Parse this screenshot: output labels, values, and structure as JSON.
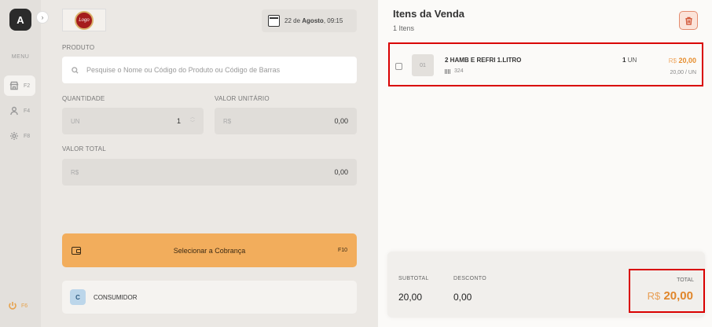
{
  "sidebar": {
    "avatar_letter": "A",
    "menu_label": "MENU",
    "items": [
      {
        "icon": "store-icon",
        "key": "F2",
        "active": true
      },
      {
        "icon": "user-icon",
        "key": "F4",
        "active": false
      },
      {
        "icon": "gear-icon",
        "key": "F8",
        "active": false
      }
    ],
    "power_key": "F6"
  },
  "header": {
    "logo_text": "Logo",
    "date_prefix": "22 de",
    "date_month": "Agosto",
    "date_time": ", 09:15"
  },
  "form": {
    "product_label": "PRODUTO",
    "search_placeholder": "Pesquise o Nome ou Código do Produto ou Código de Barras",
    "quantity_label": "QUANTIDADE",
    "quantity_unit": "UN",
    "quantity_value": "1",
    "unit_value_label": "VALOR UNITÁRIO",
    "unit_value_currency": "R$",
    "unit_value": "0,00",
    "total_label": "VALOR TOTAL",
    "total_currency": "R$",
    "total_value": "0,00"
  },
  "charge": {
    "label": "Selecionar a Cobrança",
    "key": "F10"
  },
  "consumer": {
    "initial": "C",
    "label": "CONSUMIDOR"
  },
  "sale": {
    "title": "Itens da Venda",
    "count": "1 Itens",
    "items": [
      {
        "index": "01",
        "name": "2 HAMB E REFRI 1.LITRO",
        "code": "324",
        "qty": "1",
        "unit": "UN",
        "currency": "R$",
        "price": "20,00",
        "unit_price": "20,00 / UN"
      }
    ]
  },
  "summary": {
    "subtotal_label": "SUBTOTAL",
    "subtotal_value": "20,00",
    "discount_label": "DESCONTO",
    "discount_value": "0,00",
    "total_label": "TOTAL",
    "total_currency": "R$",
    "total_value": "20,00"
  },
  "colors": {
    "accent": "#f2ad5c",
    "total_orange": "#e0862b",
    "highlight_red": "#d90000"
  }
}
